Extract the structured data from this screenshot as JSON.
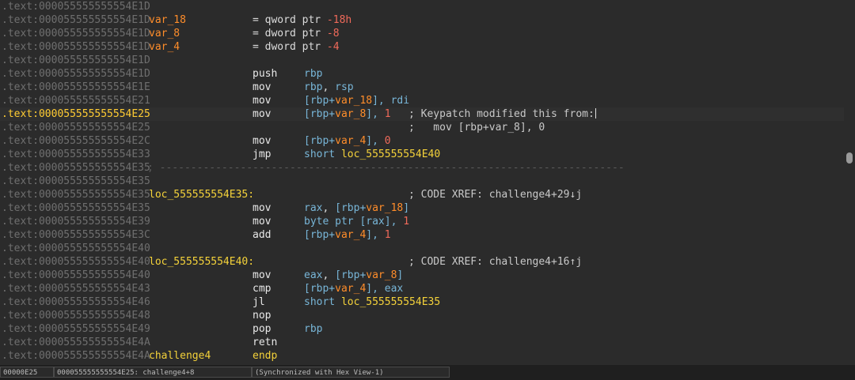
{
  "colors": {
    "background": "#2b2b2b",
    "address": "#6f6f6f",
    "current_address": "#ffcc33",
    "variable": "#ff8d2a",
    "number": "#f06a5a",
    "register": "#78b6d8",
    "location": "#f4d23a",
    "text": "#e8e8e8"
  },
  "rows": [
    {
      "addr": ".text:000055555555554E1D"
    },
    {
      "addr": ".text:000055555555554E1D",
      "label": "var_18",
      "label_class": "var",
      "op": "= qword ptr",
      "num": "-18h"
    },
    {
      "addr": ".text:000055555555554E1D",
      "label": "var_8",
      "label_class": "var",
      "op": "= dword ptr",
      "num": "-8"
    },
    {
      "addr": ".text:000055555555554E1D",
      "label": "var_4",
      "label_class": "var",
      "op": "= dword ptr",
      "num": "-4"
    },
    {
      "addr": ".text:000055555555554E1D"
    },
    {
      "addr": ".text:000055555555554E1D",
      "mnem": "push",
      "ops": [
        [
          "rbp",
          "reg"
        ]
      ]
    },
    {
      "addr": ".text:000055555555554E1E",
      "mnem": "mov",
      "ops": [
        [
          "rbp",
          "reg"
        ],
        [
          ", ",
          "eq"
        ],
        [
          "rsp",
          "reg"
        ]
      ]
    },
    {
      "addr": ".text:000055555555554E21",
      "mnem": "mov",
      "ops": [
        [
          "[rbp+",
          "reg"
        ],
        [
          "var_18",
          "var"
        ],
        [
          "], ",
          "reg"
        ],
        [
          "rdi",
          "reg"
        ]
      ]
    },
    {
      "addr": ".text:000055555555554E25",
      "current": true,
      "mnem": "mov",
      "ops": [
        [
          "[rbp+",
          "reg"
        ],
        [
          "var_8",
          "var"
        ],
        [
          "], ",
          "reg"
        ],
        [
          "1",
          "num"
        ]
      ],
      "comment": "; Keypatch modified this from:",
      "caret": true
    },
    {
      "addr": ".text:000055555555554E25",
      "comment": ";   mov [rbp+var_8], 0"
    },
    {
      "addr": ".text:000055555555554E2C",
      "mnem": "mov",
      "ops": [
        [
          "[rbp+",
          "reg"
        ],
        [
          "var_4",
          "var"
        ],
        [
          "], ",
          "reg"
        ],
        [
          "0",
          "num"
        ]
      ]
    },
    {
      "addr": ".text:000055555555554E33",
      "mnem": "jmp",
      "ops": [
        [
          "short ",
          "reg"
        ],
        [
          "loc_555555554E40",
          "loc"
        ]
      ]
    },
    {
      "addr": ".text:000055555555554E35",
      "sep": "; ---------------------------------------------------------------------------"
    },
    {
      "addr": ".text:000055555555554E35"
    },
    {
      "addr": ".text:000055555555554E35",
      "label": "loc_555555554E35:",
      "label_class": "loc",
      "comment": "; CODE XREF: challenge4+29↓j"
    },
    {
      "addr": ".text:000055555555554E35",
      "mnem": "mov",
      "ops": [
        [
          "rax",
          "reg"
        ],
        [
          ", ",
          "eq"
        ],
        [
          "[rbp+",
          "reg"
        ],
        [
          "var_18",
          "var"
        ],
        [
          "]",
          "reg"
        ]
      ]
    },
    {
      "addr": ".text:000055555555554E39",
      "mnem": "mov",
      "ops": [
        [
          "byte ptr [rax], ",
          "reg"
        ],
        [
          "1",
          "num"
        ]
      ]
    },
    {
      "addr": ".text:000055555555554E3C",
      "mnem": "add",
      "ops": [
        [
          "[rbp+",
          "reg"
        ],
        [
          "var_4",
          "var"
        ],
        [
          "], ",
          "reg"
        ],
        [
          "1",
          "num"
        ]
      ]
    },
    {
      "addr": ".text:000055555555554E40"
    },
    {
      "addr": ".text:000055555555554E40",
      "label": "loc_555555554E40:",
      "label_class": "loc",
      "comment": "; CODE XREF: challenge4+16↑j"
    },
    {
      "addr": ".text:000055555555554E40",
      "mnem": "mov",
      "ops": [
        [
          "eax",
          "reg"
        ],
        [
          ", ",
          "eq"
        ],
        [
          "[rbp+",
          "reg"
        ],
        [
          "var_8",
          "var"
        ],
        [
          "]",
          "reg"
        ]
      ]
    },
    {
      "addr": ".text:000055555555554E43",
      "mnem": "cmp",
      "ops": [
        [
          "[rbp+",
          "reg"
        ],
        [
          "var_4",
          "var"
        ],
        [
          "], ",
          "reg"
        ],
        [
          "eax",
          "reg"
        ]
      ]
    },
    {
      "addr": ".text:000055555555554E46",
      "mnem": "jl",
      "ops": [
        [
          "short ",
          "reg"
        ],
        [
          "loc_555555554E35",
          "loc"
        ]
      ]
    },
    {
      "addr": ".text:000055555555554E48",
      "mnem": "nop"
    },
    {
      "addr": ".text:000055555555554E49",
      "mnem": "pop",
      "ops": [
        [
          "rbp",
          "reg"
        ]
      ]
    },
    {
      "addr": ".text:000055555555554E4A",
      "mnem": "retn"
    },
    {
      "addr": ".text:000055555555554E4A",
      "label": "challenge4",
      "label_class": "loc",
      "endp": "endp"
    }
  ],
  "status": {
    "offset": "00000E25",
    "location": "000055555555554E25: challenge4+8",
    "sync": "(Synchronized with Hex View-1)"
  }
}
